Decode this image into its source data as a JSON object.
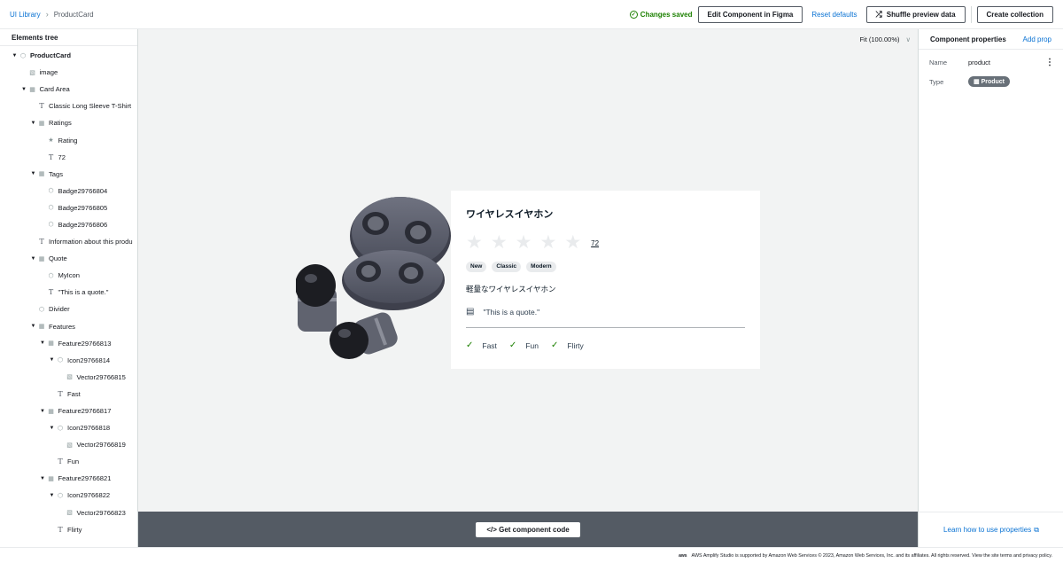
{
  "breadcrumb": {
    "root": "UI Library",
    "current": "ProductCard"
  },
  "header": {
    "status": "Changes saved",
    "edit_figma": "Edit Component in Figma",
    "reset": "Reset defaults",
    "shuffle": "Shuffle preview data",
    "create_collection": "Create collection"
  },
  "sidebar": {
    "title": "Elements tree",
    "items": [
      {
        "label": "ProductCard",
        "depth": 0,
        "caret": true,
        "icon": "component"
      },
      {
        "label": "image",
        "depth": 1,
        "caret": false,
        "icon": "image"
      },
      {
        "label": "Card Area",
        "depth": 1,
        "caret": true,
        "icon": "frame"
      },
      {
        "label": "Classic Long Sleeve T-Shirt",
        "depth": 2,
        "caret": false,
        "icon": "text"
      },
      {
        "label": "Ratings",
        "depth": 2,
        "caret": true,
        "icon": "frame"
      },
      {
        "label": "Rating",
        "depth": 3,
        "caret": false,
        "icon": "star"
      },
      {
        "label": "72",
        "depth": 3,
        "caret": false,
        "icon": "text"
      },
      {
        "label": "Tags",
        "depth": 2,
        "caret": true,
        "icon": "frame"
      },
      {
        "label": "Badge29766804",
        "depth": 3,
        "caret": false,
        "icon": "component"
      },
      {
        "label": "Badge29766805",
        "depth": 3,
        "caret": false,
        "icon": "component"
      },
      {
        "label": "Badge29766806",
        "depth": 3,
        "caret": false,
        "icon": "component"
      },
      {
        "label": "Information about this produ",
        "depth": 2,
        "caret": false,
        "icon": "text"
      },
      {
        "label": "Quote",
        "depth": 2,
        "caret": true,
        "icon": "frame"
      },
      {
        "label": "MyIcon",
        "depth": 3,
        "caret": false,
        "icon": "component"
      },
      {
        "label": "\"This is a quote.\"",
        "depth": 3,
        "caret": false,
        "icon": "text"
      },
      {
        "label": "Divider",
        "depth": 2,
        "caret": false,
        "icon": "component"
      },
      {
        "label": "Features",
        "depth": 2,
        "caret": true,
        "icon": "frame"
      },
      {
        "label": "Feature29766813",
        "depth": 3,
        "caret": true,
        "icon": "frame"
      },
      {
        "label": "Icon29766814",
        "depth": 4,
        "caret": true,
        "icon": "component"
      },
      {
        "label": "Vector29766815",
        "depth": 5,
        "caret": false,
        "icon": "image"
      },
      {
        "label": "Fast",
        "depth": 4,
        "caret": false,
        "icon": "text"
      },
      {
        "label": "Feature29766817",
        "depth": 3,
        "caret": true,
        "icon": "frame"
      },
      {
        "label": "Icon29766818",
        "depth": 4,
        "caret": true,
        "icon": "component"
      },
      {
        "label": "Vector29766819",
        "depth": 5,
        "caret": false,
        "icon": "image"
      },
      {
        "label": "Fun",
        "depth": 4,
        "caret": false,
        "icon": "text"
      },
      {
        "label": "Feature29766821",
        "depth": 3,
        "caret": true,
        "icon": "frame"
      },
      {
        "label": "Icon29766822",
        "depth": 4,
        "caret": true,
        "icon": "component"
      },
      {
        "label": "Vector29766823",
        "depth": 5,
        "caret": false,
        "icon": "image"
      },
      {
        "label": "Flirty",
        "depth": 4,
        "caret": false,
        "icon": "text"
      }
    ]
  },
  "canvas": {
    "zoom": "Fit (100.00%)",
    "code_button": "</> Get component code"
  },
  "card": {
    "title": "ワイヤレスイヤホン",
    "rating_value": 0,
    "rating_max": 5,
    "rating_count": "72",
    "tags": [
      "New",
      "Classic",
      "Modern"
    ],
    "description": "軽量なワイヤレスイヤホン",
    "quote": "\"This is a quote.\"",
    "features": [
      "Fast",
      "Fun",
      "Flirty"
    ]
  },
  "props": {
    "title": "Component properties",
    "add": "Add prop",
    "name_key": "Name",
    "name_value": "product",
    "type_key": "Type",
    "type_value": "Product",
    "learn": "Learn how to use properties"
  },
  "footer": {
    "logo": "aws",
    "text": "AWS Amplify Studio is supported by Amazon Web Services © 2023, Amazon Web Services, Inc. and its affiliates. All rights reserved. View the site terms and privacy policy."
  },
  "colors": {
    "accent": "#0972d3",
    "success": "#1d8102",
    "canvas": "#f2f3f3",
    "bottom_bar": "#545b64"
  }
}
